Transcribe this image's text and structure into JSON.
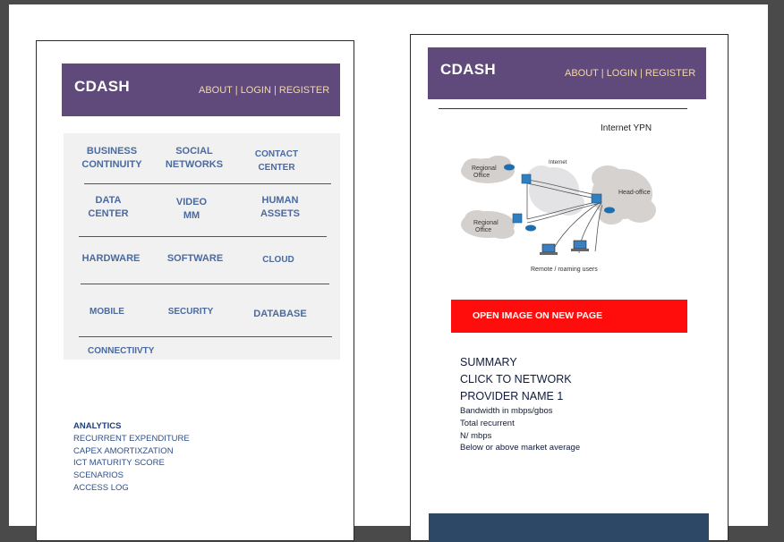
{
  "left_page": {
    "header": {
      "brand": "CDASH",
      "nav": {
        "about": "ABOUT",
        "login": "LOGIN",
        "register": "REGISTER",
        "separator": "|"
      }
    },
    "menu": {
      "business_continuity": [
        "BUSINESS",
        "CONTINUITY"
      ],
      "social_networks": [
        "SOCIAL",
        "NETWORKS"
      ],
      "contact_center": [
        "CONTACT",
        "CENTER"
      ],
      "data_center": [
        "DATA",
        "CENTER"
      ],
      "video_mm": [
        "VIDEO",
        "MM"
      ],
      "human_assets": [
        "HUMAN",
        "ASSETS"
      ],
      "hardware": "HARDWARE",
      "software": "SOFTWARE",
      "cloud": "CLOUD",
      "mobile": "MOBILE",
      "security": "SECURITY",
      "database": "DATABASE",
      "connectivity": "CONNECTIIVTY"
    },
    "analytics": {
      "heading": "ANALYTICS",
      "items": [
        "RECURRENT EXPENDITURE",
        "CAPEX AMORTIXZATION",
        "ICT MATURITY SCORE",
        "SCENARIOS",
        "ACCESS LOG"
      ]
    }
  },
  "right_page": {
    "header": {
      "brand": "CDASH",
      "nav": {
        "about": "ABOUT",
        "login": "LOGIN",
        "register": "REGISTER",
        "separator": "|"
      }
    },
    "diagram": {
      "title": "Internet YPN",
      "labels": {
        "regional_office_1": [
          "Regional",
          "Office"
        ],
        "internet": "Internet",
        "head_office": "Head-office",
        "regional_office_2": [
          "Regional",
          "Office"
        ],
        "remote_users": "Remote / roaming users"
      }
    },
    "open_image_button": "OPEN IMAGE ON NEW PAGE",
    "summary": {
      "lines_big": [
        "SUMMARY",
        "CLICK TO NETWORK",
        "PROVIDER NAME 1"
      ],
      "lines_small": [
        "Bandwidth in mbps/gbos",
        "Total recurrent",
        "N/ mbps",
        "Below or above market average"
      ]
    }
  },
  "colors": {
    "header_bg": "#604a7b",
    "nav_text": "#f3d9a4",
    "menu_text": "#4a6aa0",
    "button_red": "#ff0d0d",
    "footer_bar": "#2d4766"
  }
}
